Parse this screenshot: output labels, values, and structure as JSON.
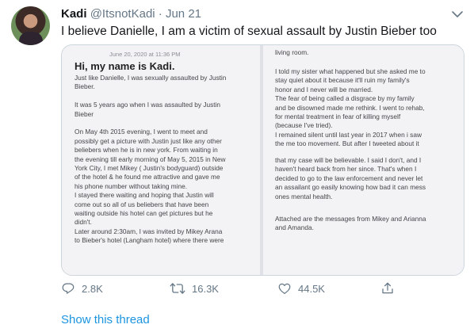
{
  "tweet": {
    "display_name": "Kadi",
    "handle": "@ItsnotKadi",
    "separator": "·",
    "date": "Jun 21",
    "text": "I believe Danielle, I am a victim of sexual assault by Justin Bieber too"
  },
  "image": {
    "timestamp": "June 20, 2020 at 11:36 PM",
    "heading": "Hi, my name is Kadi.",
    "left_lines": [
      [
        "Just like Danielle, I was sexually assaulted by Justin",
        "Bieber."
      ],
      [
        "It was 5 years ago when I was assaulted by Justin",
        "Bieber"
      ],
      [
        "On May 4th 2015 evening, I went to meet and",
        "possibly get a picture with Justin just like any other",
        "beliebers when he is in new york. From waiting in",
        "the evening till early morning of May 5, 2015 in New",
        "York City, I met Mikey ( Justin's bodyguard) outside",
        "of the hotel & he found me attractive and gave me",
        "his phone number without taking mine.",
        "I stayed there waiting and hoping that Justin will",
        "come out so all of us beliebers that have been",
        "waiting outside his hotel can get pictures but he",
        "didn't.",
        "Later around 2:30am, I was invited by Mikey Arana",
        "to Bieber's hotel (Langham hotel) where there were"
      ]
    ],
    "right_lines_top": [
      "living room."
    ],
    "right_lines_mid": [
      "I told my sister what happened but she asked me to",
      "stay quiet about it because it'll ruin my family's",
      "honor and I never will be married.",
      "The fear of being called a disgrace by my family",
      "and be disowned made me rethink. I went to rehab,",
      "for mental treatment in fear of killing myself",
      "(because I've tried).",
      "I remained silent until last year in 2017 when i saw",
      "the me too movement. But after I tweeted about it"
    ],
    "right_lines_bottom": [
      "that my case will be believable. I said I don't, and I",
      "haven't heard back from her since. That's when I",
      "decided to go to the law enforcement and never let",
      "an assailant go easily knowing how bad it can mess",
      "ones mental health."
    ],
    "right_lines_end": [
      "Attached are the messages from Mikey and Arianna",
      "and Amanda."
    ]
  },
  "actions": {
    "reply_count": "2.8K",
    "retweet_count": "16.3K",
    "like_count": "44.5K"
  },
  "show_thread_label": "Show this thread",
  "colors": {
    "accent": "#1b95e0",
    "muted": "#657786"
  }
}
